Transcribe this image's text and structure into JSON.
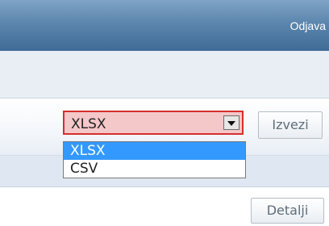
{
  "header": {
    "logout_label": "Odjava"
  },
  "export": {
    "format_select": {
      "selected": "XLSX",
      "options": [
        "XLSX",
        "CSV"
      ]
    },
    "export_button_label": "Izvezi"
  },
  "row": {
    "details_button_label": "Detalji"
  }
}
